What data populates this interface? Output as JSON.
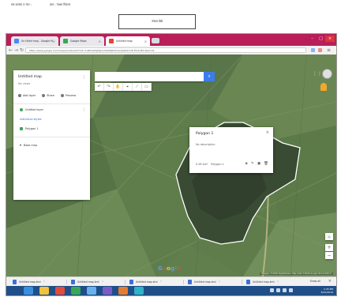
{
  "doc": {
    "header_left": "सत्र क्रमांक व नाम :",
    "header_right": "ग्राम :  नक्शा विवरण",
    "button_label": "नक्शा देखें"
  },
  "browser": {
    "tabs": [
      {
        "label": "Un titled map - Google My",
        "color": "#4a8af4"
      },
      {
        "label": "Google Maps",
        "color": "#3aa757"
      },
      {
        "label": "Untitled map",
        "color": "#e2453c"
      }
    ],
    "url": "https://www.google.com/maps/d/u/0/edit?mid=1aBcDeFgHiJkLmNoPqRsTuVwXyZ&ll=26.8%2C80.9&z=16"
  },
  "mymaps_panel": {
    "title": "Untitled map",
    "subtitle": "No views",
    "actions": [
      "Add layer",
      "Share",
      "Preview"
    ],
    "layer_title": "Untitled layer",
    "layer_style": "Individual styles",
    "layer_item": "Polygon 1",
    "basemap_label": "Base map"
  },
  "map": {
    "search_placeholder": "Search",
    "popup": {
      "title": "Polygon 1",
      "description": "No description",
      "footer_label": "Polygon 1",
      "area_label": "0.28 km²"
    },
    "logo_letters": [
      "G",
      "o",
      "o",
      "g",
      "l",
      "e"
    ],
    "attribution": "Imagery ©2016 DigitalGlobe, Map data ©2016 Google   Terms   500 m"
  },
  "downloads_bar": {
    "items": [
      "Untitled map.kml",
      "Untitled map.kml",
      "Untitled map.kml",
      "Untitled map.kml",
      "Untitled map.kml"
    ],
    "show_all": "Show all"
  },
  "taskbar": {
    "clock_time": "2:45 PM",
    "clock_date": "6/24/2016",
    "button_colors": [
      "#3b8fe0",
      "#f3c13a",
      "#e44b3b",
      "#3aa757",
      "#6ab0f0",
      "#7a5cc8",
      "#e77b2c",
      "#2fb3c6"
    ]
  }
}
